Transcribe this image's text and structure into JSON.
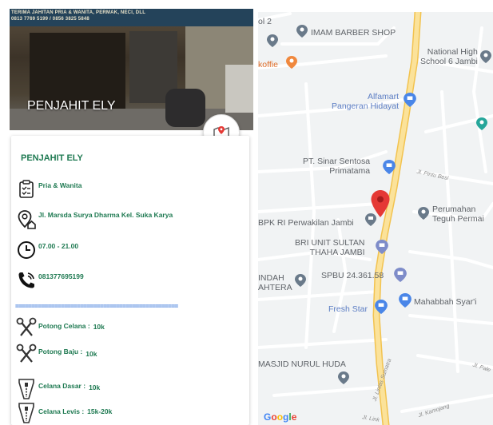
{
  "shop": {
    "banner_line1": "TERIMA JAHITAN PRIA & WANITA, PERMAK, NECI, DLL",
    "banner_line2": "0813 7769 5199 / 0856 3825 5848",
    "photo_title": "PENJAHIT ELY",
    "name": "PENJAHIT ELY",
    "category": "Pria & Wanita",
    "address": "Jl. Marsda Surya Dharma Kel. Suka Karya",
    "hours": "07.00 - 21.00",
    "phone": "081377695199",
    "divider": "=================================================="
  },
  "icons": {
    "map_button": "map-location-icon",
    "category": "clipboard-check-icon",
    "address": "location-home-icon",
    "hours": "clock-icon",
    "phone": "phone-icon",
    "scissors": "scissors-icon",
    "zipper": "zipper-icon"
  },
  "prices": [
    {
      "label": "Potong Celana :",
      "value": "10k",
      "icon": "scissors"
    },
    {
      "label": "Potong Baju   :",
      "value": "10k",
      "icon": "scissors"
    },
    {
      "label": "Celana Dasar   :",
      "value": "10k",
      "icon": "zipper"
    },
    {
      "label": "Celana Levis   :",
      "value": "15k-20k",
      "icon": "zipper"
    }
  ],
  "map": {
    "labels": {
      "ol2": "ol 2",
      "imam": "IMAM BARBER SHOP",
      "national": "National High\nSchool 6 Jambi",
      "koffie": "koffie",
      "alfamart": "Alfamart\nPangeran Hidayat",
      "pt_sinar": "PT. Sinar Sentosa\nPrimatama",
      "pintu_besi": "Jl. Pintu Besi",
      "perumahan": "Perumahan\nTeguh Permai",
      "bpk": "BPK RI Perwakilan Jambi",
      "bri": "BRI UNIT SULTAN\nTHAHA JAMBI",
      "indah": "INDAH\nAHTERA",
      "spbu": "SPBU 24.361.58",
      "fresh": "Fresh Star",
      "mahabbah": "Mahabbah Syar'i",
      "masjid": "MASJID NURUL HUDA",
      "jl_pale": "Jl. Pale",
      "jl_sumbawa": "Jl. Lintas Sumatra",
      "jl_link": "Jl. Link",
      "jl_kamojang": "Jl. Kamojang"
    },
    "attribution": "Google",
    "colors": {
      "road_major": "#f9d77a",
      "road_minor": "#ffffff",
      "background": "#f1f3f4",
      "pin": "#e53935"
    }
  },
  "colors": {
    "text_green": "#1f7a52",
    "divider_blue": "#2f6fd8"
  }
}
